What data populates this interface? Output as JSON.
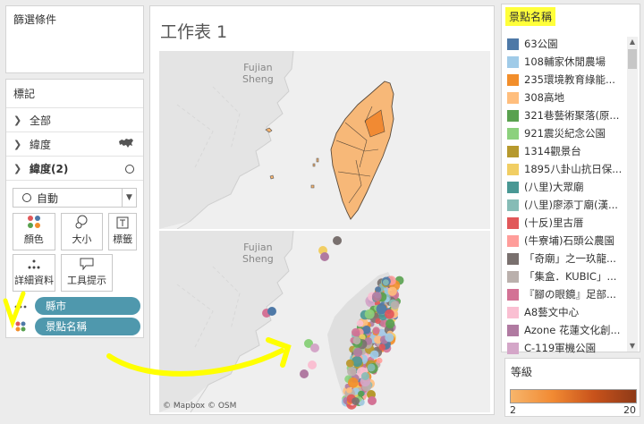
{
  "filters": {
    "title": "篩選條件"
  },
  "marks": {
    "title": "標記",
    "rows": [
      {
        "label": "全部"
      },
      {
        "label": "緯度"
      },
      {
        "label": "緯度(2)"
      }
    ],
    "mark_type": "自動",
    "buttons": [
      "顏色",
      "大小",
      "標籤",
      "詳細資料",
      "工具提示"
    ],
    "pills": [
      {
        "label": "縣市",
        "icon": "detail-icon"
      },
      {
        "label": "景點名稱",
        "icon": "color-dots-icon"
      }
    ]
  },
  "sheet": {
    "title": "工作表 1",
    "map_label_1": "Fujian",
    "map_label_2": "Sheng",
    "attribution": "© Mapbox © OSM"
  },
  "legend": {
    "title": "景點名稱",
    "items": [
      {
        "label": "63公園",
        "color": "#4e79a7"
      },
      {
        "label": "108輔家休閒農場",
        "color": "#a0cbe8"
      },
      {
        "label": "235環境教育綠能...",
        "color": "#f28e2b"
      },
      {
        "label": "308高地",
        "color": "#ffbe7d"
      },
      {
        "label": "321巷藝術聚落(原...",
        "color": "#59a14f"
      },
      {
        "label": "921震災紀念公園",
        "color": "#8cd17d"
      },
      {
        "label": "1314觀景台",
        "color": "#b6992d"
      },
      {
        "label": "1895八卦山抗日保...",
        "color": "#f1ce63"
      },
      {
        "label": "(八里)大眾廟",
        "color": "#499894"
      },
      {
        "label": "(八里)廖添丁廟(漢...",
        "color": "#86bcb6"
      },
      {
        "label": "(十反)里古厝",
        "color": "#e15759"
      },
      {
        "label": "(牛寮埔)石頭公農園",
        "color": "#ff9d9a"
      },
      {
        "label": "「奇廟」之一玖龍...",
        "color": "#79706e"
      },
      {
        "label": "「集盒．KUBIC」...",
        "color": "#bab0ac"
      },
      {
        "label": "『腳の眼鏡』足部...",
        "color": "#d37295"
      },
      {
        "label": "A8藝文中心",
        "color": "#fabfd2"
      },
      {
        "label": "Azone 花蓮文化創...",
        "color": "#b07aa1"
      },
      {
        "label": "C-119軍機公園",
        "color": "#d4a6c8"
      }
    ]
  },
  "grade": {
    "title": "等級",
    "min": "2",
    "max": "20"
  }
}
